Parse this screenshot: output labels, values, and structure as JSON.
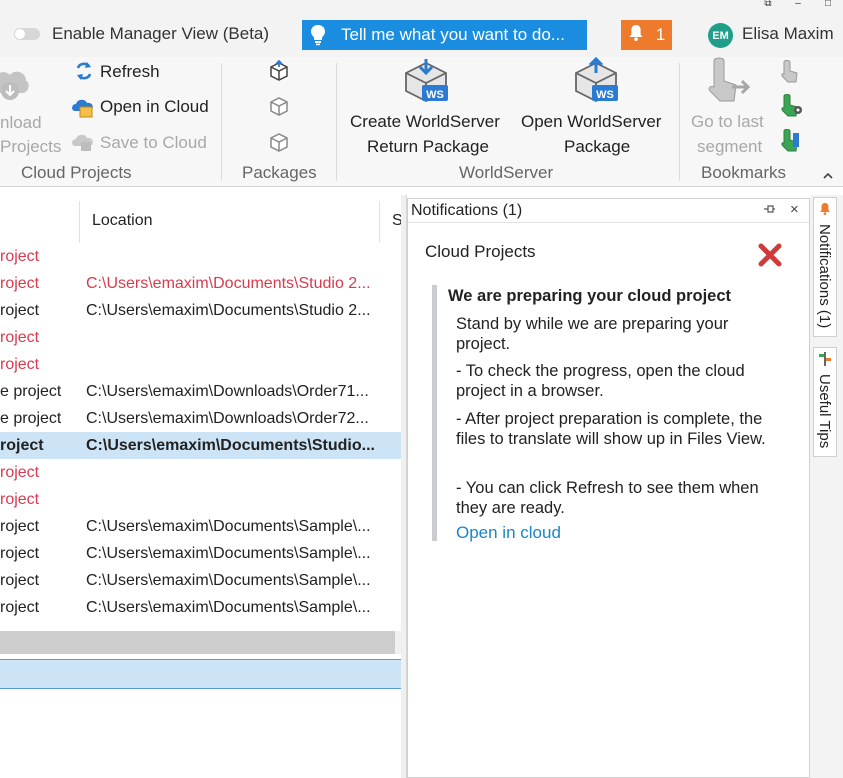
{
  "window_controls": {
    "restore": "⧉",
    "minimize": "–",
    "maximize": "□"
  },
  "topbar": {
    "manager_view_label": "Enable Manager View (Beta)",
    "manager_view_on": false,
    "tell_me_placeholder": "Tell me what you want to do...",
    "notification_count": "1",
    "user_initials": "EM",
    "user_name": "Elisa Maxim"
  },
  "ribbon": {
    "cloud_projects": {
      "download_line1": "nload",
      "download_line2": "Projects",
      "refresh": "Refresh",
      "open_in_cloud": "Open in Cloud",
      "save_to_cloud": "Save to Cloud",
      "group_label": "Cloud Projects"
    },
    "packages": {
      "group_label": "Packages"
    },
    "worldserver": {
      "create_line1": "Create WorldServer",
      "create_line2": "Return Package",
      "open_line1": "Open WorldServer",
      "open_line2": "Package",
      "group_label": "WorldServer",
      "ws_badge": "WS"
    },
    "bookmarks": {
      "go_last_line1": "Go to last",
      "go_last_line2": "segment",
      "group_label": "Bookmarks"
    },
    "collapse_icon": "chevron-up-icon"
  },
  "file_list": {
    "headers": {
      "location": "Location",
      "s": "S"
    },
    "rows": [
      {
        "name": "roject",
        "location": "",
        "style": "red"
      },
      {
        "name": "roject",
        "location": "C:\\Users\\emaxim\\Documents\\Studio 2...",
        "style": "red"
      },
      {
        "name": "roject",
        "location": "C:\\Users\\emaxim\\Documents\\Studio 2...",
        "style": "normal"
      },
      {
        "name": "roject",
        "location": "",
        "style": "red"
      },
      {
        "name": "roject",
        "location": "",
        "style": "red"
      },
      {
        "name": "e project",
        "location": "C:\\Users\\emaxim\\Downloads\\Order71...",
        "style": "normal"
      },
      {
        "name": "e project",
        "location": "C:\\Users\\emaxim\\Downloads\\Order72...",
        "style": "normal"
      },
      {
        "name": "roject",
        "location": "C:\\Users\\emaxim\\Documents\\Studio...",
        "style": "selected"
      },
      {
        "name": "roject",
        "location": "",
        "style": "red"
      },
      {
        "name": "roject",
        "location": "",
        "style": "red"
      },
      {
        "name": "roject",
        "location": "C:\\Users\\emaxim\\Documents\\Sample\\...",
        "style": "normal"
      },
      {
        "name": "roject",
        "location": "C:\\Users\\emaxim\\Documents\\Sample\\...",
        "style": "normal"
      },
      {
        "name": "roject",
        "location": "C:\\Users\\emaxim\\Documents\\Sample\\...",
        "style": "normal"
      },
      {
        "name": "roject",
        "location": "C:\\Users\\emaxim\\Documents\\Sample\\...",
        "style": "normal"
      }
    ]
  },
  "notifications_panel": {
    "title": "Notifications (1)",
    "pin_icon": "pin-icon",
    "close": "×",
    "card": {
      "title": "Cloud Projects",
      "heading": "We are preparing your cloud project",
      "paragraphs": [
        "Stand by while we are preparing your project.",
        "- To check the progress, open the cloud project in a browser.",
        "- After project preparation is complete, the files to translate will show up in Files View.",
        "- You can click Refresh to see them when they are ready."
      ],
      "link": "Open in cloud"
    }
  },
  "side_tabs": {
    "notifications": "Notifications (1)",
    "useful_tips": "Useful Tips"
  },
  "colors": {
    "accent_blue": "#1a8de0",
    "notification_orange": "#ee7b2b",
    "error_red": "#d93a4e",
    "selection": "#cce4f6",
    "link": "#1a86c8"
  }
}
